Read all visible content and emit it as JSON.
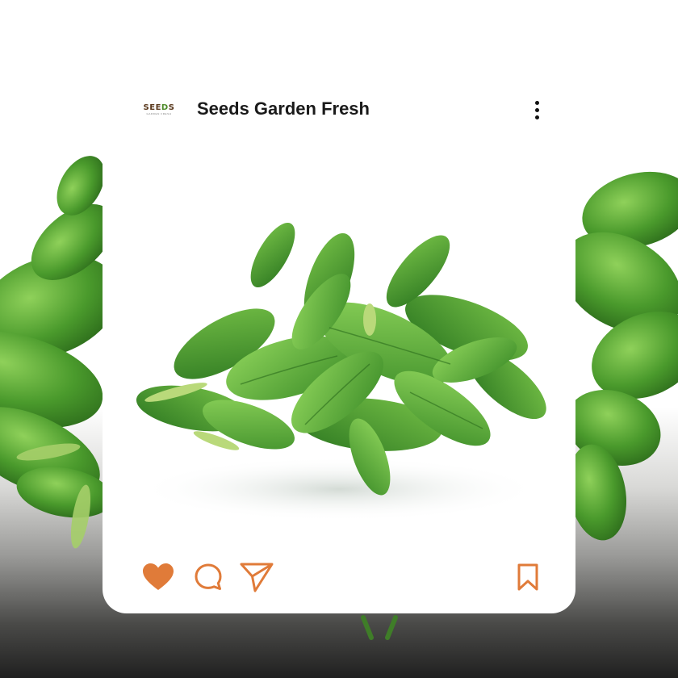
{
  "post": {
    "account_name": "Seeds Garden Fresh",
    "avatar": {
      "logo_text_prefix": "SEE",
      "logo_text_o": "D",
      "logo_text_suffix": "S",
      "logo_subtext": "GARDEN FRESH"
    },
    "image_subject": "fresh-basil-leaves",
    "actions": {
      "like_icon": "heart-icon",
      "comment_icon": "comment-icon",
      "share_icon": "send-icon",
      "bookmark_icon": "bookmark-icon",
      "liked": true
    }
  },
  "colors": {
    "accent": "#E07B39",
    "text": "#1A1A1A",
    "leaf_dark": "#3F8F2A",
    "leaf_light": "#7CC24A",
    "card_background": "#FFFFFF"
  }
}
